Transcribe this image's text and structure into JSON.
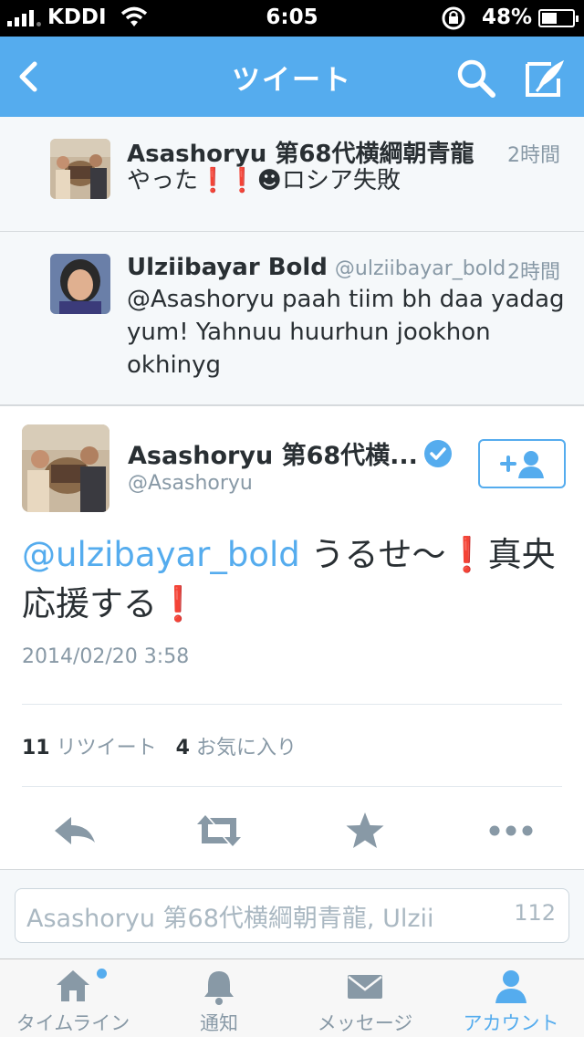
{
  "status_bar": {
    "carrier": "KDDI",
    "time": "6:05",
    "battery": "48%",
    "battery_level": 0.48
  },
  "nav": {
    "title": "ツイート"
  },
  "tweets": [
    {
      "name": "Asashoryu 第68代横綱朝青龍",
      "handle": "",
      "time": "2時間",
      "text_before": "やった",
      "text_after": "ロシア失敗"
    },
    {
      "name": "Ulziibayar Bold",
      "handle": "@ulziibayar_bold",
      "time": "2時間",
      "text": "@Asashoryu paah tiim bh daa yadag yum! Yahnuu huurhun jookhon okhinyg"
    }
  ],
  "main_tweet": {
    "name": "Asashoryu 第68代横...",
    "handle": "@Asashoryu",
    "mention": "@ulzibayar_bold",
    "text_part1": "うるせ〜",
    "text_part2": "真央応援する",
    "date": "2014/02/20 3:58",
    "retweet_count": "11",
    "retweet_label": "リツイート",
    "favorite_count": "4",
    "favorite_label": "お気に入り"
  },
  "reply": {
    "placeholder": "Asashoryu 第68代横綱朝青龍, Ulzii",
    "char_count": "112"
  },
  "tabs": [
    {
      "label": "タイムライン",
      "icon": "home-icon"
    },
    {
      "label": "通知",
      "icon": "bell-icon"
    },
    {
      "label": "メッセージ",
      "icon": "envelope-icon"
    },
    {
      "label": "アカウント",
      "icon": "person-icon"
    }
  ],
  "colors": {
    "brand": "#55acee",
    "background": "#f5f8fa",
    "text": "#292f33",
    "muted": "#8899a6",
    "exclamation": "#dd2e44"
  }
}
